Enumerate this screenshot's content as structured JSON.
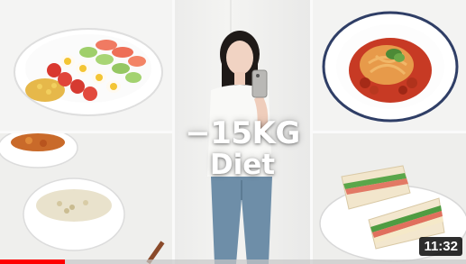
{
  "thumbnail": {
    "overlay_line1": "−15KG",
    "overlay_line2": "Diet",
    "duration": "11:32",
    "progress_fraction": 0.14,
    "progress_color": "#ff0000"
  },
  "tiles": [
    {
      "name": "salad-bowl-photo",
      "icon": "food-photo"
    },
    {
      "name": "side-bowls-photo",
      "icon": "food-photo"
    },
    {
      "name": "woman-selfie-photo",
      "icon": "person-photo"
    },
    {
      "name": "pasta-plate-photo",
      "icon": "food-photo"
    },
    {
      "name": "sandwich-plate-photo",
      "icon": "food-photo"
    }
  ]
}
